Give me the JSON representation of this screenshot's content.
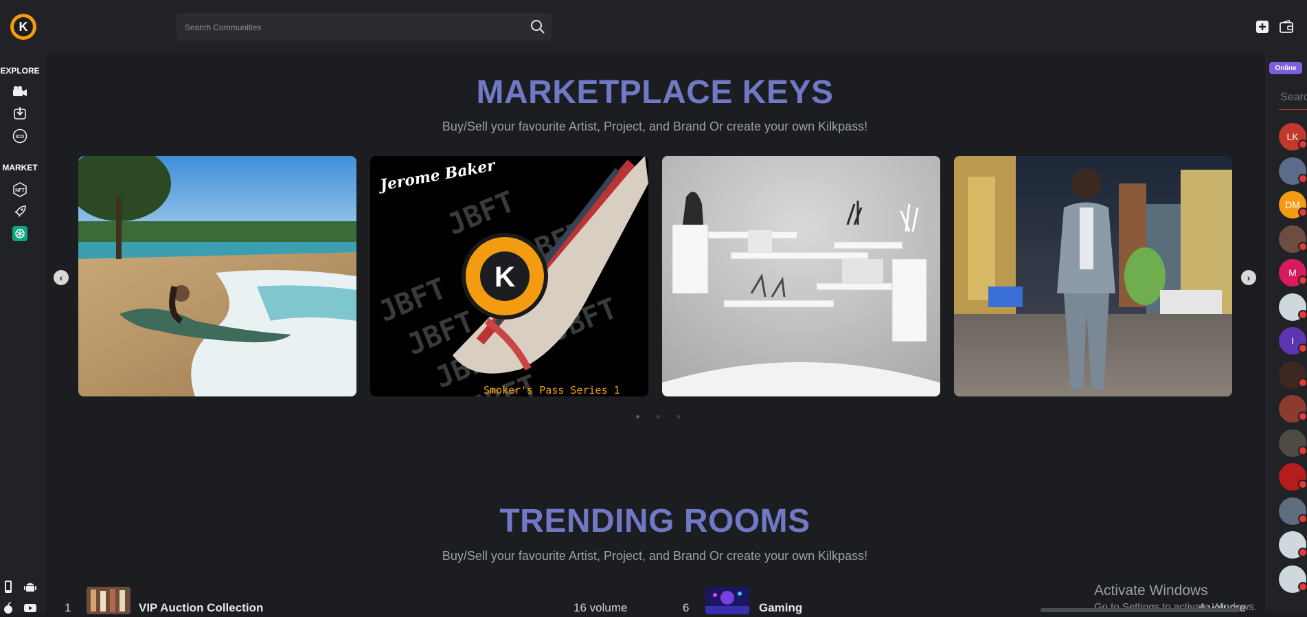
{
  "app": {
    "logo_letter": "K"
  },
  "search": {
    "placeholder": "Search Communities"
  },
  "sidebar": {
    "explore_label": "EXPLORE",
    "market_label": "MARKET",
    "explore_items": [
      {
        "icon": "video-camera-icon"
      },
      {
        "icon": "download-icon"
      },
      {
        "icon": "ico-icon"
      }
    ],
    "market_items": [
      {
        "icon": "nft-icon"
      },
      {
        "icon": "rocket-icon"
      },
      {
        "icon": "openai-icon",
        "active": true
      }
    ],
    "bottom_icons": [
      "mobile-icon",
      "android-icon",
      "apple-icon",
      "youtube-icon"
    ]
  },
  "rightbar": {
    "status": "Online",
    "search_placeholder": "Search",
    "users": [
      {
        "initials": "LK",
        "color": "#c0392b"
      },
      {
        "initials": "",
        "color": "#5a6b8c"
      },
      {
        "initials": "DM",
        "color": "#f39c12"
      },
      {
        "initials": "",
        "color": "#6d4c41"
      },
      {
        "initials": "M",
        "color": "#d81b60"
      },
      {
        "initials": "",
        "color": "#cfd8dc"
      },
      {
        "initials": "I",
        "color": "#5e35b1"
      },
      {
        "initials": "",
        "color": "#3e2723"
      },
      {
        "initials": "",
        "color": "#8d3b2f"
      },
      {
        "initials": "",
        "color": "#4e4a44"
      },
      {
        "initials": "",
        "color": "#b71c1c"
      },
      {
        "initials": "",
        "color": "#5d6d7e"
      },
      {
        "initials": "",
        "color": "#cfd8dc"
      },
      {
        "initials": "",
        "color": "#cfd8dc"
      }
    ]
  },
  "marketplace": {
    "title": "MARKETPLACE KEYS",
    "subtitle": "Buy/Sell your favourite Artist, Project, and Brand Or create your own Kilkpass!",
    "cards": [
      {
        "name": "beach-photo"
      },
      {
        "name": "jerome-baker-pass",
        "brand_text": "Jerome Baker",
        "watermark_text": "JBFT",
        "caption": "Smoker's Pass Series 1",
        "logo_letter": "K"
      },
      {
        "name": "white-shelf-photo"
      },
      {
        "name": "city-night-photo"
      }
    ]
  },
  "trending": {
    "title": "TRENDING ROOMS",
    "subtitle": "Buy/Sell your favourite Artist, Project, and Brand Or create your own Kilkpass!",
    "rooms": [
      {
        "rank": "1",
        "name": "VIP Auction Collection",
        "volume": "16 volume"
      },
      {
        "rank": "6",
        "name": "Gaming",
        "volume": "4 volume"
      }
    ]
  },
  "os_watermark": {
    "line1": "Activate Windows",
    "line2": "Go to Settings to activate Windows."
  },
  "colors": {
    "accent": "#7179c6",
    "brand_orange": "#f39c12",
    "online": "#7b5fe0",
    "active_icon": "#11a37f"
  }
}
